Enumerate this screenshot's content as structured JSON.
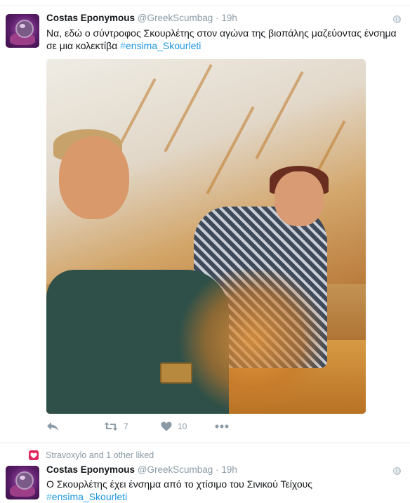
{
  "tweets": [
    {
      "author_name": "Costas Eponymous",
      "handle": "@GreekScumbag",
      "separator": "·",
      "time": "19h",
      "text": "Να, εδώ ο σύντροφος Σκουρλέτης στον αγώνα της βιοπάλης μαζεύοντας ένσημα σε μια κολεκτίβα ",
      "hashtag_symbol": "#",
      "hashtag_text": "ensima_Skourleti",
      "actions": {
        "reply_icon": "reply-icon",
        "retweet_icon": "retweet-icon",
        "retweet_count": "7",
        "like_icon": "heart-icon",
        "like_count": "10",
        "more_icon": "more-icon"
      }
    },
    {
      "context": "Stravoxylo and 1 other liked",
      "author_name": "Costas Eponymous",
      "handle": "@GreekScumbag",
      "separator": "·",
      "time": "19h",
      "text": "Ο Σκουρλέτης έχει ένσημα από το χτίσιμο του Σινικού Τείχους ",
      "hashtag_symbol": "#",
      "hashtag_text": "ensima_Skourleti"
    }
  ],
  "colors": {
    "link": "#1b95e0",
    "muted": "#8a9aa6",
    "like": "#e0245e",
    "divider": "#e6ecf0"
  }
}
